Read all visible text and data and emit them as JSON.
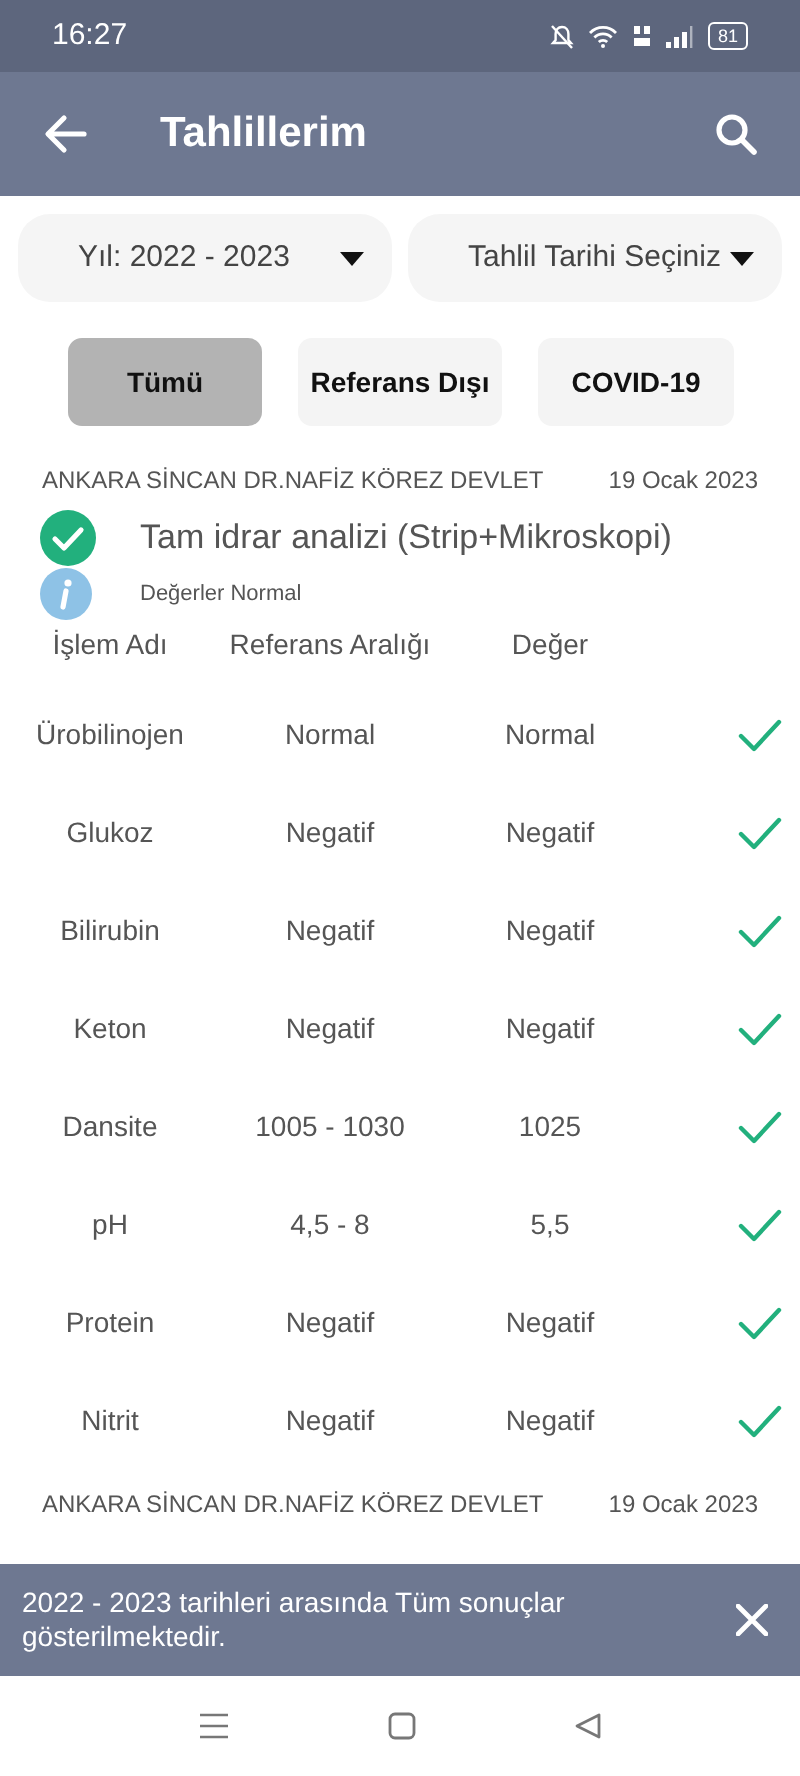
{
  "status_bar": {
    "time": "16:27",
    "battery": "81"
  },
  "app_bar": {
    "title": "Tahlillerim"
  },
  "filters": [
    {
      "label": "Yıl: 2022 - 2023"
    },
    {
      "label": "Tahlil Tarihi Seçiniz"
    }
  ],
  "chips": [
    {
      "label": "Tümü",
      "selected": true
    },
    {
      "label": "Referans Dışı",
      "selected": false
    },
    {
      "label": "COVID-19",
      "selected": false
    }
  ],
  "results": [
    {
      "hospital": "ANKARA SİNCAN DR.NAFİZ KÖREZ DEVLET",
      "date": "19 Ocak 2023",
      "test": "Tam idrar analizi (Strip+Mikroskopi)",
      "normal": true,
      "note": "Değerler Normal",
      "columns": [
        "İşlem Adı",
        "Referans Aralığı",
        "Değer"
      ],
      "rows": [
        {
          "name": "Ürobilinojen",
          "range": "Normal",
          "value": "Normal",
          "in_range": true
        },
        {
          "name": "Glukoz",
          "range": "Negatif",
          "value": "Negatif",
          "in_range": true
        },
        {
          "name": "Bilirubin",
          "range": "Negatif",
          "value": "Negatif",
          "in_range": true
        },
        {
          "name": "Keton",
          "range": "Negatif",
          "value": "Negatif",
          "in_range": true
        },
        {
          "name": "Dansite",
          "range": "1005 - 1030",
          "value": "1025",
          "in_range": true
        },
        {
          "name": "pH",
          "range": "4,5 - 8",
          "value": "5,5",
          "in_range": true
        },
        {
          "name": "Protein",
          "range": "Negatif",
          "value": "Negatif",
          "in_range": true
        },
        {
          "name": "Nitrit",
          "range": "Negatif",
          "value": "Negatif",
          "in_range": true
        }
      ]
    },
    {
      "hospital": "ANKARA SİNCAN DR.NAFİZ KÖREZ DEVLET",
      "date": "19 Ocak 2023"
    }
  ],
  "snackbar": {
    "message": "2022 - 2023 tarihleri arasında Tüm sonuçlar gösterilmektedir."
  }
}
